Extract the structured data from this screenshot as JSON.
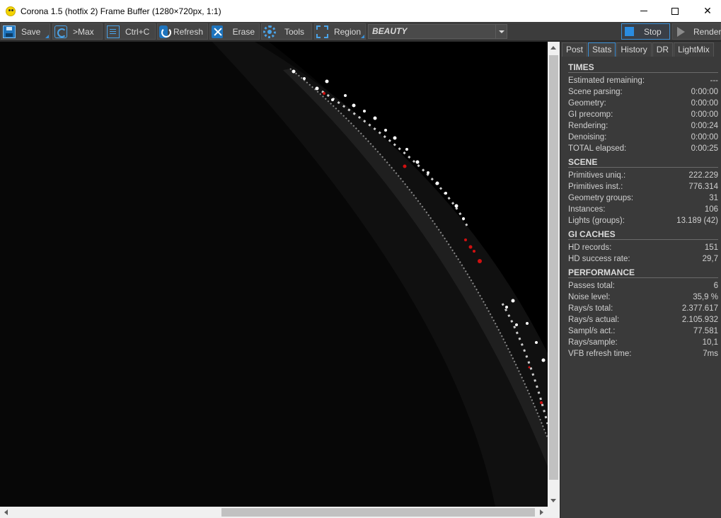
{
  "window": {
    "title": "Corona 1.5 (hotfix 2) Frame Buffer (1280×720px, 1:1)",
    "close_glyph": "✕"
  },
  "toolbar": {
    "save_label": "Save",
    "max_label": ">Max",
    "copy_label": "Ctrl+C",
    "refresh_label": "Refresh",
    "erase_label": "Erase",
    "tools_label": "Tools",
    "region_label": "Region",
    "pass_value": "BEAUTY",
    "stop_label": "Stop",
    "render_label": "Render"
  },
  "tabs": [
    {
      "label": "Post"
    },
    {
      "label": "Stats"
    },
    {
      "label": "History"
    },
    {
      "label": "DR"
    },
    {
      "label": "LightMix"
    }
  ],
  "stats": {
    "times": {
      "title": "TIMES",
      "rows": [
        {
          "label": "Estimated remaining:",
          "value": "---"
        },
        {
          "label": "Scene parsing:",
          "value": "0:00:00"
        },
        {
          "label": "Geometry:",
          "value": "0:00:00"
        },
        {
          "label": "GI precomp:",
          "value": "0:00:00"
        },
        {
          "label": "Rendering:",
          "value": "0:00:24"
        },
        {
          "label": "Denoising:",
          "value": "0:00:00"
        },
        {
          "label": "TOTAL elapsed:",
          "value": "0:00:25"
        }
      ]
    },
    "scene": {
      "title": "SCENE",
      "rows": [
        {
          "label": "Primitives uniq.:",
          "value": "222.229"
        },
        {
          "label": "Primitives inst.:",
          "value": "776.314"
        },
        {
          "label": "Geometry groups:",
          "value": "31"
        },
        {
          "label": "Instances:",
          "value": "106"
        },
        {
          "label": "Lights (groups):",
          "value": "13.189 (42)"
        }
      ]
    },
    "gi": {
      "title": "GI CACHES",
      "rows": [
        {
          "label": "HD records:",
          "value": "151"
        },
        {
          "label": "HD success rate:",
          "value": "29,7"
        }
      ]
    },
    "perf": {
      "title": "PERFORMANCE",
      "rows": [
        {
          "label": "Passes total:",
          "value": "6"
        },
        {
          "label": "Noise level:",
          "value": "35,9 %"
        },
        {
          "label": "Rays/s total:",
          "value": "2.377.617"
        },
        {
          "label": "Rays/s actual:",
          "value": "2.105.932"
        },
        {
          "label": "Sampl/s act.:",
          "value": "77.581"
        },
        {
          "label": "Rays/sample:",
          "value": "10,1"
        },
        {
          "label": "VFB refresh time:",
          "value": "7ms"
        }
      ]
    }
  },
  "colors": {
    "accent": "#3a8fd6",
    "panel_bg": "#3a3a3a",
    "toolbar_bg": "#3c3c3c"
  }
}
